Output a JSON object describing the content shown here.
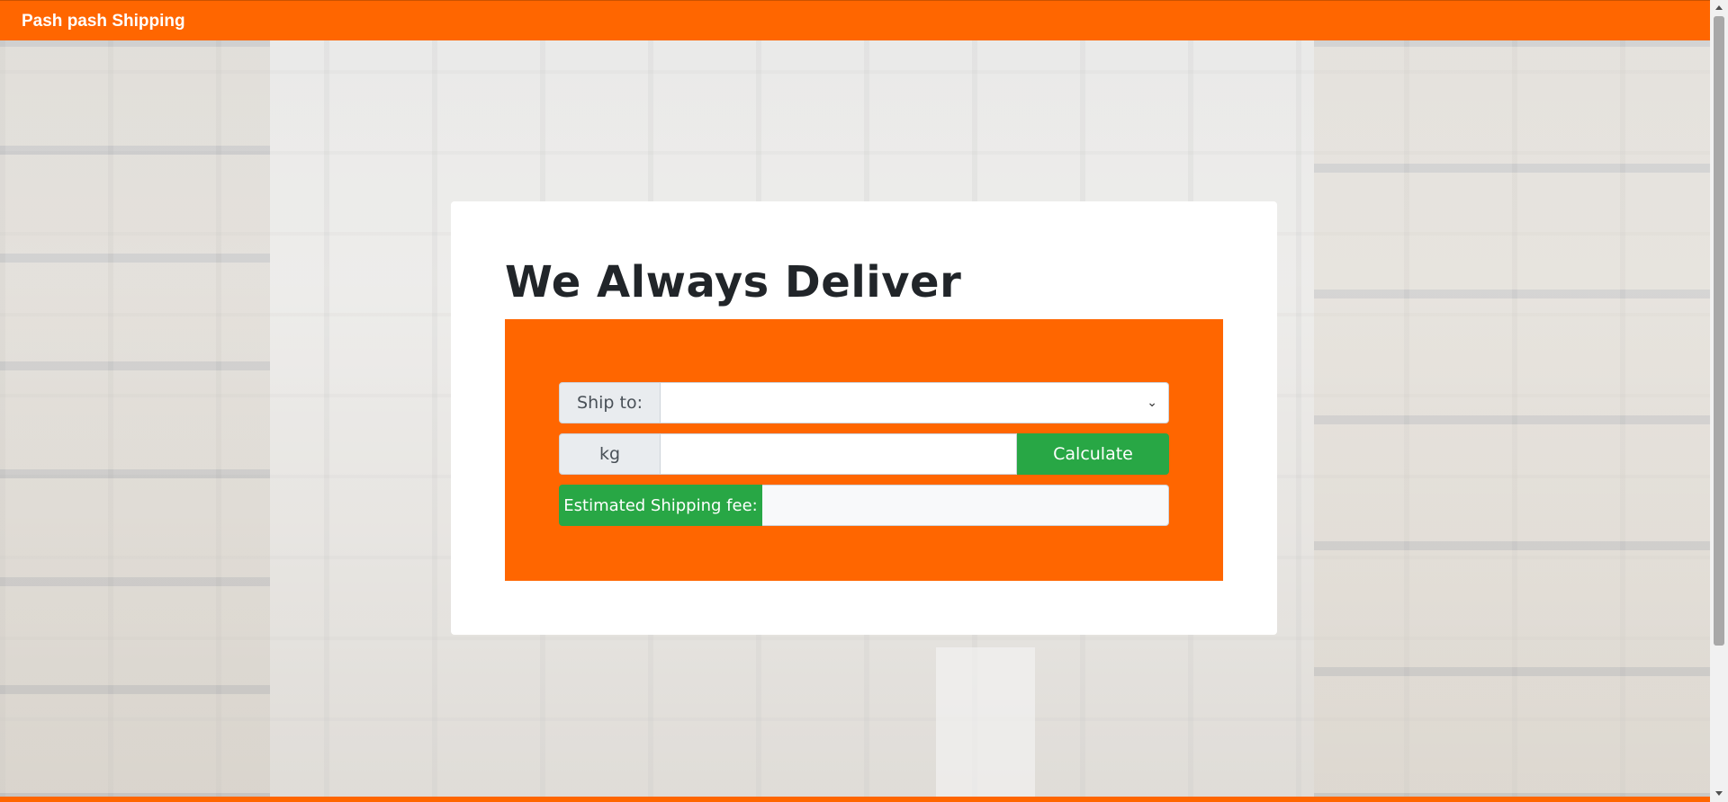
{
  "navbar": {
    "brand": "Pash pash Shipping",
    "color": "#ff6600"
  },
  "main": {
    "title": "We Always Deliver",
    "form": {
      "ship_to_label": "Ship to:",
      "ship_to_value": "",
      "weight_label": "kg",
      "weight_value": "",
      "calculate_label": "Calculate",
      "fee_label": "Estimated Shipping fee:",
      "fee_value": ""
    }
  },
  "colors": {
    "accent": "#ff6600",
    "success": "#28a745"
  }
}
